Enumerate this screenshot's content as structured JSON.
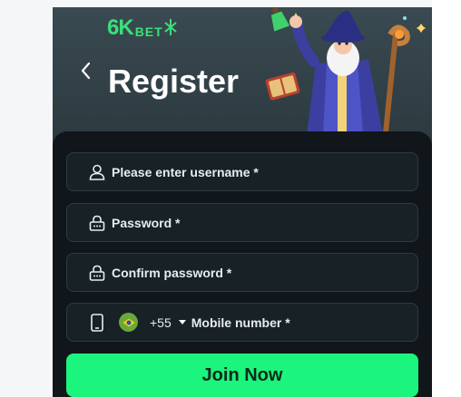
{
  "brand": {
    "logo_main": "6K",
    "logo_sub": "BET"
  },
  "header": {
    "title": "Register"
  },
  "form": {
    "username_placeholder": "Please enter username *",
    "password_placeholder": "Password *",
    "confirm_password_placeholder": "Confirm password *",
    "country_code": "+55",
    "mobile_placeholder": "Mobile number *",
    "submit_label": "Join Now"
  },
  "icons": {
    "back": "chevron-left-icon",
    "username": "user-icon",
    "password": "lock-icon",
    "confirm": "lock-icon",
    "mobile": "phone-icon",
    "flag": "brazil-flag-icon",
    "dropdown": "caret-down-icon"
  },
  "colors": {
    "accent": "#1bf47d",
    "logo": "#39e07a",
    "card": "#101619",
    "header": "#2f3e46",
    "field": "#172126"
  }
}
